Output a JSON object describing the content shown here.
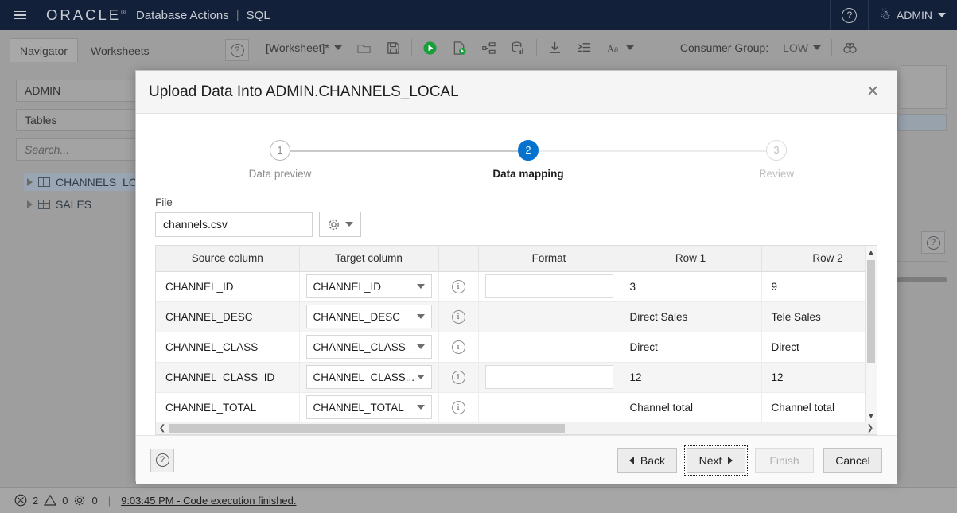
{
  "topbar": {
    "menu_icon": "hamburger-icon",
    "brand": "ORACLE",
    "brand_mark": "®",
    "product": "Database Actions",
    "separator": "|",
    "section": "SQL",
    "help_icon": "help-circle-icon",
    "user_icon": "user-icon",
    "user_name": "ADMIN"
  },
  "sidebar": {
    "tabs": [
      {
        "label": "Navigator",
        "active": true
      },
      {
        "label": "Worksheets",
        "active": false
      }
    ],
    "help_icon": "help-circle-icon",
    "schema": "ADMIN",
    "object_type": "Tables",
    "search_placeholder": "Search...",
    "tree": [
      {
        "label": "CHANNELS_LOC",
        "icon": "table-icon",
        "selected": true
      },
      {
        "label": "SALES",
        "icon": "table-icon",
        "selected": false
      }
    ]
  },
  "worksheet_toolbar": {
    "worksheet_label": "[Worksheet]*",
    "icons": [
      "open-folder-icon",
      "save-icon",
      "run-statement-icon",
      "run-script-icon",
      "explain-plan-icon",
      "autotrace-icon",
      "download-icon",
      "format-sql-icon",
      "font-size-icon"
    ],
    "consumer_group_label": "Consumer Group:",
    "consumer_group_value": "LOW",
    "find_icon": "binoculars-icon"
  },
  "statusbar": {
    "error_icon": "error-circle-icon",
    "error_count": "2",
    "warning_icon": "warning-triangle-icon",
    "warning_count": "0",
    "settings_icon": "gear-icon",
    "settings_count": "0",
    "separator": "|",
    "message": "9:03:45 PM - Code execution finished."
  },
  "dialog": {
    "title": "Upload Data Into ADMIN.CHANNELS_LOCAL",
    "close_icon": "close-icon",
    "stepper": [
      {
        "number": "1",
        "label": "Data preview",
        "state": "done"
      },
      {
        "number": "2",
        "label": "Data mapping",
        "state": "active"
      },
      {
        "number": "3",
        "label": "Review",
        "state": "todo"
      }
    ],
    "file_label": "File",
    "file_value": "channels.csv",
    "settings_icon": "gear-icon",
    "settings_caret": "chevron-down-icon",
    "grid": {
      "headers": [
        "Source column",
        "Target column",
        "",
        "Format",
        "Row 1",
        "Row 2"
      ],
      "rows": [
        {
          "source": "CHANNEL_ID",
          "target": "CHANNEL_ID",
          "info_icon": "info-icon",
          "format": "",
          "has_format_input": true,
          "row1": "3",
          "row2": "9"
        },
        {
          "source": "CHANNEL_DESC",
          "target": "CHANNEL_DESC",
          "info_icon": "info-icon",
          "format": "",
          "has_format_input": false,
          "row1": "Direct Sales",
          "row2": "Tele Sales"
        },
        {
          "source": "CHANNEL_CLASS",
          "target": "CHANNEL_CLASS",
          "info_icon": "info-icon",
          "format": "",
          "has_format_input": false,
          "row1": "Direct",
          "row2": "Direct"
        },
        {
          "source": "CHANNEL_CLASS_ID",
          "target": "CHANNEL_CLASS...",
          "info_icon": "info-icon",
          "format": "",
          "has_format_input": true,
          "row1": "12",
          "row2": "12"
        },
        {
          "source": "CHANNEL_TOTAL",
          "target": "CHANNEL_TOTAL",
          "info_icon": "info-icon",
          "format": "",
          "has_format_input": false,
          "row1": "Channel total",
          "row2": "Channel total"
        }
      ],
      "vscroll_up_icon": "chevron-up-icon",
      "vscroll_down_icon": "chevron-down-icon",
      "hscroll_left_icon": "chevron-left-icon",
      "hscroll_right_icon": "chevron-right-icon"
    },
    "footer": {
      "help_icon": "help-circle-icon",
      "back_label": "Back",
      "next_label": "Next",
      "finish_label": "Finish",
      "cancel_label": "Cancel"
    }
  },
  "colors": {
    "topbar_bg": "#13203a",
    "accent_blue": "#0572ce",
    "run_green": "#1a9e3c"
  }
}
